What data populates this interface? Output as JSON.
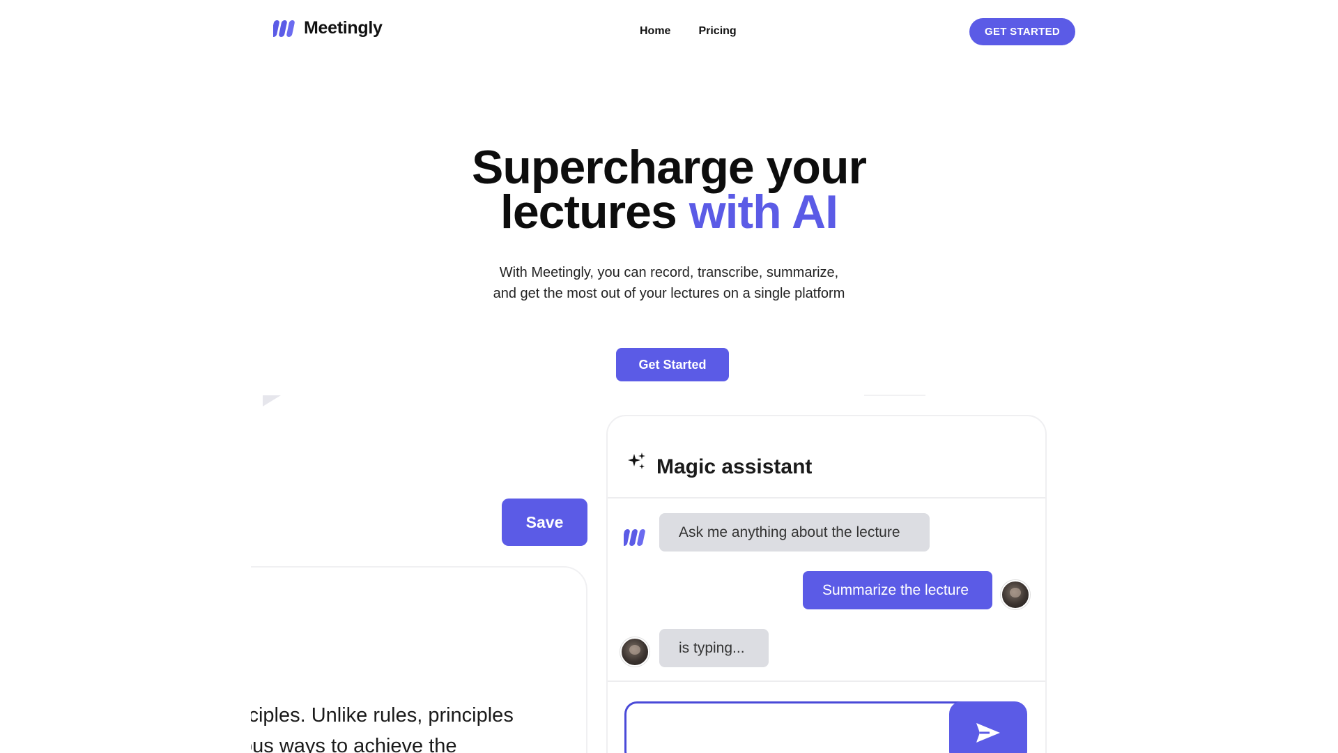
{
  "brand": {
    "name": "Meetingly",
    "accent_color": "#5b5be6"
  },
  "nav": {
    "items": [
      {
        "label": "Home"
      },
      {
        "label": "Pricing"
      }
    ],
    "cta_label": "GET STARTED"
  },
  "hero": {
    "title_line1": "Supercharge your",
    "title_line2_plain": "lectures",
    "title_line2_accent": "with AI",
    "subtitle_line1": "With Meetingly, you can record, transcribe, summarize,",
    "subtitle_line2": "and get the most out of your lectures on a single platform",
    "cta_label": "Get Started"
  },
  "editor_preview": {
    "save_label": "Save",
    "text_line1": "iciples. Unlike rules, principles",
    "text_line2": "ous ways to achieve the"
  },
  "assistant": {
    "title": "Magic assistant",
    "icon": "sparkles-icon",
    "messages": [
      {
        "from": "bot",
        "text": "Ask me anything about the lecture"
      },
      {
        "from": "user",
        "text": "Summarize the lecture"
      },
      {
        "from": "other",
        "text": "is typing..."
      }
    ],
    "input": {
      "value": "",
      "placeholder": ""
    },
    "send_icon": "send-icon"
  }
}
